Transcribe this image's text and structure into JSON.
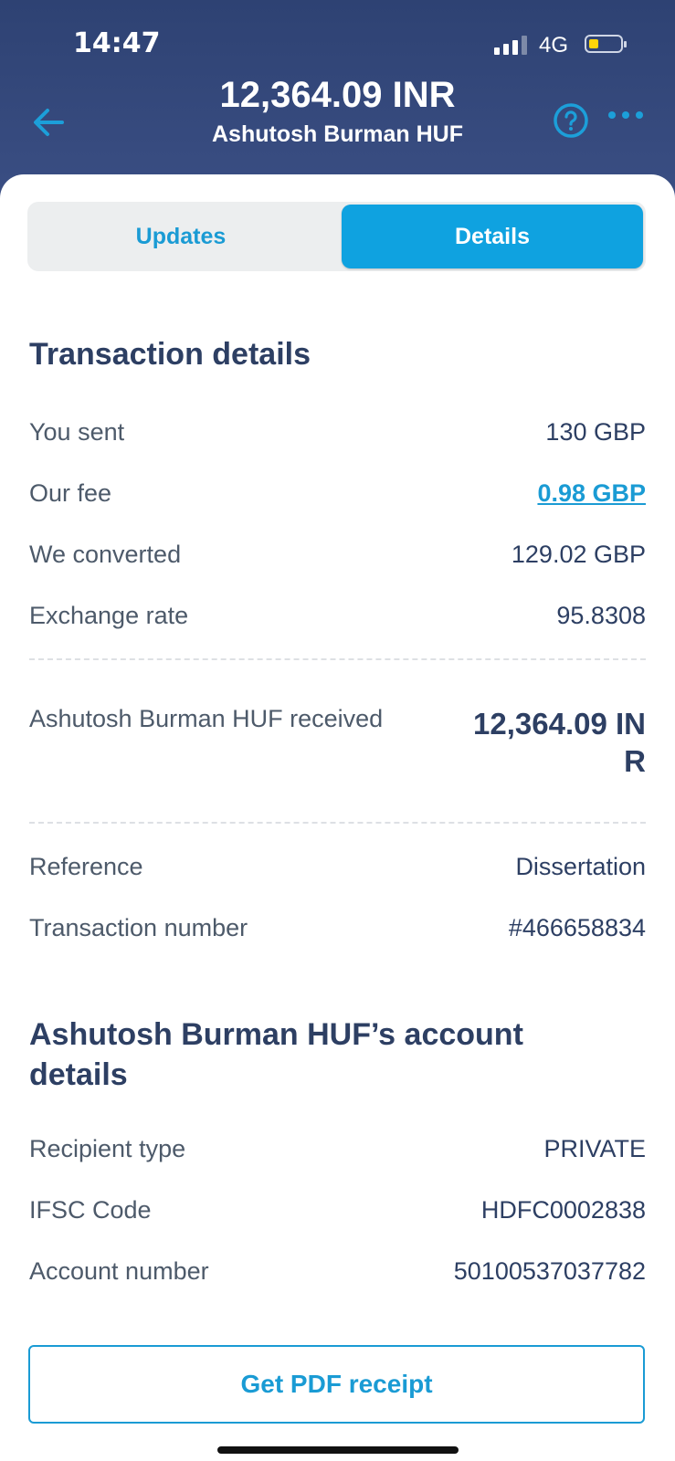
{
  "status_bar": {
    "time": "14:47",
    "network": "4G"
  },
  "header": {
    "amount": "12,364.09 INR",
    "recipient": "Ashutosh Burman HUF"
  },
  "icons": {
    "back": "arrow-left-icon",
    "help": "question-circle-icon",
    "more": "more-dots-icon"
  },
  "tabs": {
    "updates": "Updates",
    "details": "Details",
    "selected": "Details"
  },
  "transaction": {
    "title": "Transaction details",
    "you_sent_label": "You sent",
    "you_sent_value": "130 GBP",
    "fee_label": "Our fee",
    "fee_value": "0.98 GBP",
    "converted_label": "We converted",
    "converted_value": "129.02 GBP",
    "rate_label": "Exchange rate",
    "rate_value": "95.8308",
    "received_label": "Ashutosh Burman HUF received",
    "received_value": "12,364.09 INR",
    "reference_label": "Reference",
    "reference_value": "Dissertation",
    "txn_number_label": "Transaction number",
    "txn_number_value": "#466658834"
  },
  "account": {
    "title": "Ashutosh Burman HUF’s account details",
    "recipient_type_label": "Recipient type",
    "recipient_type_value": "PRIVATE",
    "ifsc_label": "IFSC Code",
    "ifsc_value": "HDFC0002838",
    "account_number_label": "Account number",
    "account_number_value": "50100537037782"
  },
  "actions": {
    "pdf_receipt": "Get PDF receipt"
  },
  "colors": {
    "accent": "#1a9bd4",
    "header_bg": "#33467a",
    "heading": "#2d3f63",
    "battery": "#ffd60a"
  }
}
